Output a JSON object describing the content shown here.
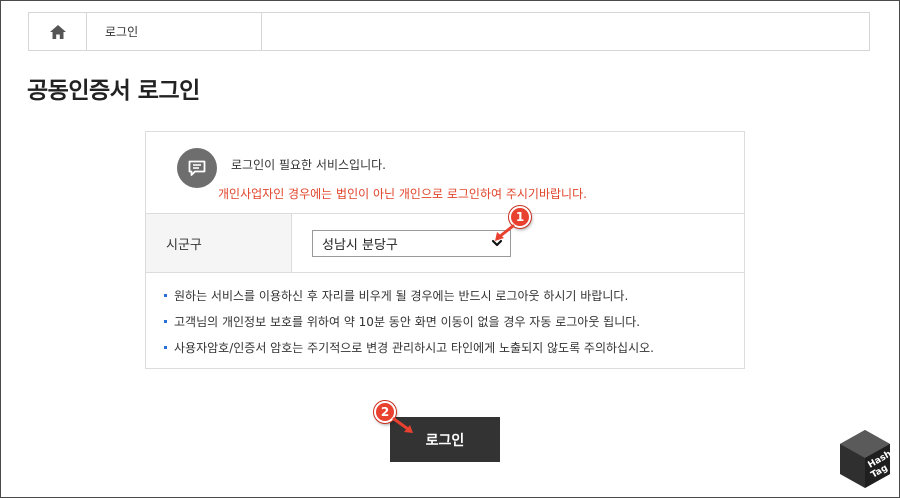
{
  "breadcrumb": {
    "home_icon": "home-icon",
    "current": "로그인"
  },
  "page_title": "공동인증서 로그인",
  "notice": {
    "icon": "message-icon",
    "line1": "로그인이 필요한 서비스입니다.",
    "line2": "개인사업자인 경우에는 법인이 아닌 개인으로 로그인하여 주시기바랍니다.",
    "warning_color": "#e0452b"
  },
  "region": {
    "label": "시군구",
    "selected": "성남시 분당구"
  },
  "info": [
    "원하는 서비스를 이용하신 후 자리를 비우게 될 경우에는 반드시 로그아웃 하시기 바랍니다.",
    "고객님의 개인정보 보호를 위하여 약 10분 동안 화면 이동이 없을 경우 자동 로그아웃 됩니다.",
    "사용자암호/인증서 암호는 주기적으로 변경 관리하시고 타인에게 노출되지 않도록 주의하십시오."
  ],
  "login_button": "로그인",
  "annotations": {
    "step1": "1",
    "step2": "2",
    "marker_color": "#e8412f"
  },
  "watermark": "HashTag"
}
